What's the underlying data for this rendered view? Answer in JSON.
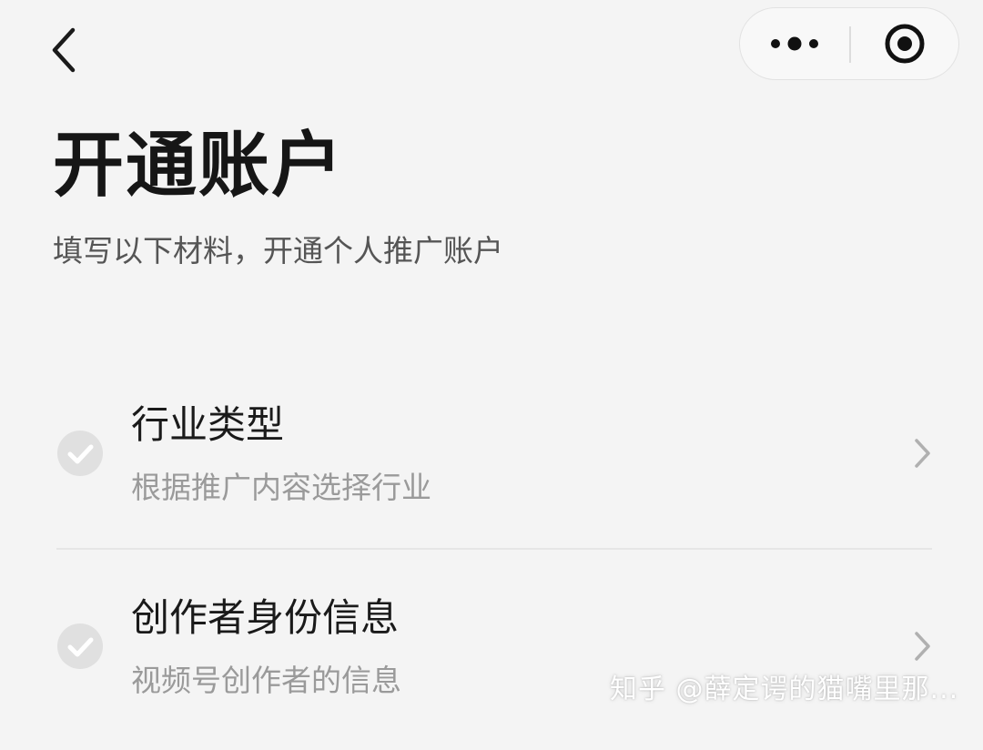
{
  "header": {
    "back_icon": "chevron-left-icon",
    "more_icon": "more-dots-icon",
    "close_icon": "target-close-icon"
  },
  "page": {
    "title": "开通账户",
    "subtitle": "填写以下材料，开通个人推广账户"
  },
  "items": [
    {
      "title": "行业类型",
      "description": "根据推广内容选择行业",
      "status_icon": "check-circle-icon",
      "arrow_icon": "chevron-right-icon"
    },
    {
      "title": "创作者身份信息",
      "description": "视频号创作者的信息",
      "status_icon": "check-circle-icon",
      "arrow_icon": "chevron-right-icon"
    }
  ],
  "watermark": "知乎 @薛定谔的猫嘴里那...",
  "colors": {
    "background": "#f4f4f4",
    "title_text": "#161616",
    "subtitle_text": "#555555",
    "muted_text": "#9a9a9a",
    "check_circle": "#e0e0e0",
    "divider": "#e6e6e6"
  }
}
